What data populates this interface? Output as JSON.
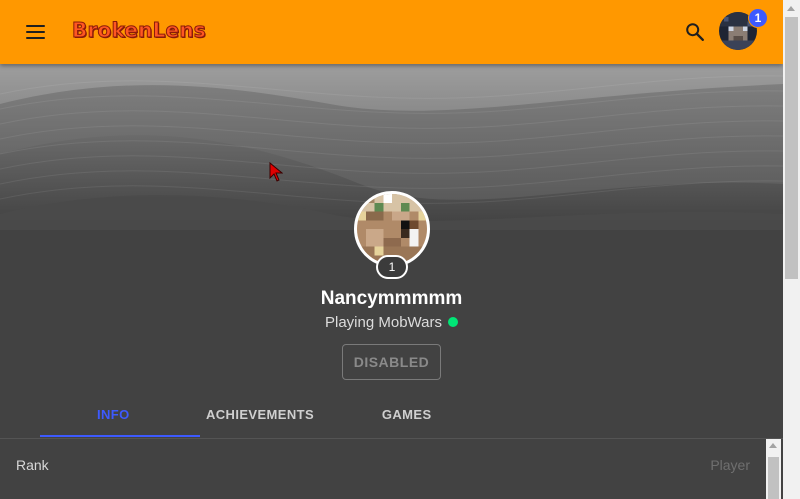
{
  "app": {
    "logo_text": "BrokenLens",
    "brand_color": "#ff9800",
    "accent_color": "#3d5afe"
  },
  "header": {
    "menu_icon": "hamburger-menu-icon",
    "search_icon": "search-icon",
    "notification_count": "1"
  },
  "profile": {
    "level": "1",
    "username": "Nancymmmmm",
    "status_text": "Playing MobWars",
    "status_color": "#00e676",
    "action_button": "DISABLED"
  },
  "tabs": [
    {
      "label": "INFO",
      "active": true
    },
    {
      "label": "ACHIEVEMENTS",
      "active": false
    },
    {
      "label": "GAMES",
      "active": false
    }
  ],
  "info": {
    "rows": [
      {
        "label": "Rank",
        "value": "Player"
      }
    ]
  }
}
